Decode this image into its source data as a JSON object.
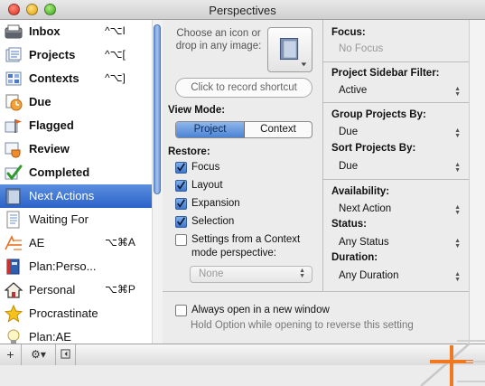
{
  "window": {
    "title": "Perspectives"
  },
  "sidebar": {
    "items": [
      {
        "label": "Inbox",
        "shortcut": "^⌥I",
        "icon": "inbox-tray-icon",
        "bold": true
      },
      {
        "label": "Projects",
        "shortcut": "^⌥[",
        "icon": "projects-icon",
        "bold": true
      },
      {
        "label": "Contexts",
        "shortcut": "^⌥]",
        "icon": "contexts-icon",
        "bold": true
      },
      {
        "label": "Due",
        "shortcut": "",
        "icon": "due-clock-icon",
        "bold": true
      },
      {
        "label": "Flagged",
        "shortcut": "",
        "icon": "flag-icon",
        "bold": true
      },
      {
        "label": "Review",
        "shortcut": "",
        "icon": "review-coffee-icon",
        "bold": true
      },
      {
        "label": "Completed",
        "shortcut": "",
        "icon": "checkmark-icon",
        "bold": true
      },
      {
        "label": "Next Actions",
        "shortcut": "",
        "icon": "folder-icon",
        "bold": false,
        "selected": true
      },
      {
        "label": "Waiting For",
        "shortcut": "",
        "icon": "checklist-icon",
        "bold": false
      },
      {
        "label": "AE",
        "shortcut": "⌥⌘A",
        "icon": "ae-logo-icon",
        "bold": false
      },
      {
        "label": "Plan:Perso...",
        "shortcut": "",
        "icon": "book-icon",
        "bold": false
      },
      {
        "label": "Personal",
        "shortcut": "⌥⌘P",
        "icon": "house-icon",
        "bold": false
      },
      {
        "label": "Procrastinate",
        "shortcut": "",
        "icon": "star-icon",
        "bold": false
      },
      {
        "label": "Plan:AE",
        "shortcut": "",
        "icon": "bulb-icon",
        "bold": false
      }
    ]
  },
  "toolbar": {
    "add_label": "+",
    "gear_label": "⚙▾"
  },
  "middle": {
    "choose_icon_text": "Choose an icon or drop in any image:",
    "shortcut_placeholder": "Click to record shortcut",
    "view_mode_label": "View Mode:",
    "view_mode_options": [
      "Project",
      "Context"
    ],
    "restore_label": "Restore:",
    "restore_options": [
      {
        "label": "Focus",
        "checked": true
      },
      {
        "label": "Layout",
        "checked": true
      },
      {
        "label": "Expansion",
        "checked": true
      },
      {
        "label": "Selection",
        "checked": true
      }
    ],
    "settings_from_context": "Settings from a Context",
    "mode_perspective": "mode perspective:",
    "none_popup": "None"
  },
  "right": {
    "focus_label": "Focus:",
    "focus_value": "No Focus",
    "sidebar_filter_label": "Project Sidebar Filter:",
    "sidebar_filter_value": "Active",
    "group_by_label": "Group Projects By:",
    "group_by_value": "Due",
    "sort_by_label": "Sort Projects By:",
    "sort_by_value": "Due",
    "availability_label": "Availability:",
    "availability_value": "Next Action",
    "status_label": "Status:",
    "status_value": "Any Status",
    "duration_label": "Duration:",
    "duration_value": "Any Duration"
  },
  "options": {
    "always_open": "Always open in a new window",
    "hint": "Hold Option while opening to reverse this setting"
  },
  "colors": {
    "selection": "#3b6fd0",
    "accent_orange": "#f07820"
  }
}
